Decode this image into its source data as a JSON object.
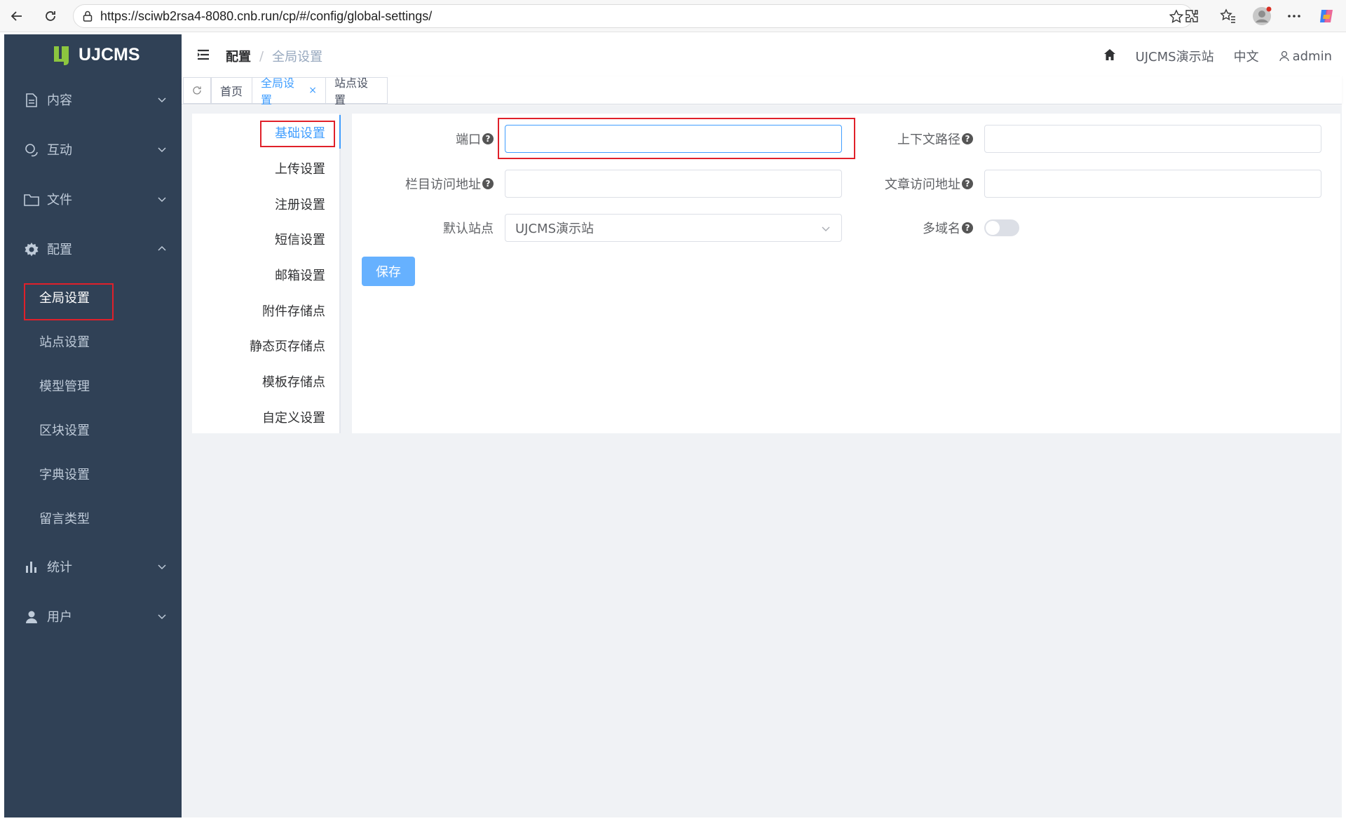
{
  "browser": {
    "url": "https://sciwb2rsa4-8080.cnb.run/cp/#/config/global-settings/"
  },
  "app": {
    "logo_text": "UJCMS"
  },
  "sidebar": {
    "items": [
      {
        "label": "内容",
        "icon": "document-icon"
      },
      {
        "label": "互动",
        "icon": "chat-icon"
      },
      {
        "label": "文件",
        "icon": "folder-icon"
      },
      {
        "label": "配置",
        "icon": "gear-icon"
      },
      {
        "label": "统计",
        "icon": "bar-chart-icon"
      },
      {
        "label": "用户",
        "icon": "user-icon"
      }
    ],
    "config_sub": [
      "全局设置",
      "站点设置",
      "模型管理",
      "区块设置",
      "字典设置",
      "留言类型"
    ],
    "active_sub": "全局设置"
  },
  "header": {
    "breadcrumb_parent": "配置",
    "breadcrumb_sep": "/",
    "breadcrumb_current": "全局设置",
    "site_name": "UJCMS演示站",
    "language": "中文",
    "username": "admin"
  },
  "tabs": [
    {
      "label": "首页"
    },
    {
      "label": "全局设置",
      "closable": "×"
    },
    {
      "label": "站点设置"
    }
  ],
  "settings_nav": [
    "基础设置",
    "上传设置",
    "注册设置",
    "短信设置",
    "邮箱设置",
    "附件存储点",
    "静态页存储点",
    "模板存储点",
    "自定义设置"
  ],
  "form": {
    "port_label": "端口",
    "port_value": "",
    "context_path_label": "上下文路径",
    "context_path_value": "",
    "channel_url_label": "栏目访问地址",
    "channel_url_value": "",
    "article_url_label": "文章访问地址",
    "article_url_value": "",
    "default_site_label": "默认站点",
    "default_site_value": "UJCMS演示站",
    "multi_domain_label": "多域名",
    "multi_domain_on": false,
    "help_glyph": "?",
    "save_label": "保存"
  },
  "colors": {
    "sidebar_bg": "#304156",
    "accent": "#409eff",
    "highlight": "#e0202a"
  }
}
